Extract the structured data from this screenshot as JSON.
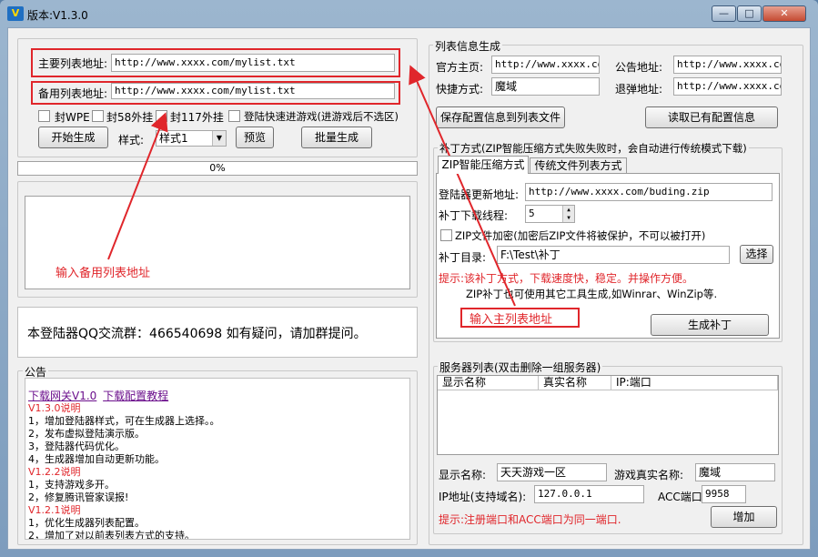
{
  "window": {
    "icon_text": "V",
    "title": "版本:V1.3.0",
    "minimize": "—",
    "maximize": "□",
    "close": "✕"
  },
  "left": {
    "primary_list_label": "主要列表地址:",
    "primary_list_value": "http://www.xxxx.com/mylist.txt",
    "backup_list_label": "备用列表地址:",
    "backup_list_value": "http://www.xxxx.com/mylist.txt",
    "checks": [
      "封WPE",
      "封58外挂",
      "封117外挂",
      "登陆快速进游戏(进游戏后不选区)"
    ],
    "start_button": "开始生成",
    "style_label": "样式:",
    "style_value": "样式1",
    "preview_button": "预览",
    "batch_button": "批量生成",
    "progress": "0%",
    "qq_text": "本登陆器QQ交流群：466540698 如有疑问，请加群提问。",
    "notice_title": "公告",
    "notice_link1": "下载网关V1.0",
    "notice_link2": "下载配置教程",
    "notice_lines": [
      {
        "text": "V1.3.0说明",
        "red": true
      },
      {
        "text": "1，增加登陆器样式，可在生成器上选择。。",
        "red": false
      },
      {
        "text": "2，发布虚拟登陆演示版。",
        "red": false
      },
      {
        "text": "3，登陆器代码优化。",
        "red": false
      },
      {
        "text": "4，生成器增加自动更新功能。",
        "red": false
      },
      {
        "text": "V1.2.2说明",
        "red": true
      },
      {
        "text": "1，支持游戏多开。",
        "red": false
      },
      {
        "text": "2，修复腾讯管家误报!",
        "red": false
      },
      {
        "text": "V1.2.1说明",
        "red": true
      },
      {
        "text": "1，优化生成器列表配置。",
        "red": false
      },
      {
        "text": "2，增加了对以前表列表方式的支持。",
        "red": false
      }
    ]
  },
  "right": {
    "list_group_title": "列表信息生成",
    "homepage_label": "官方主页:",
    "homepage_value": "http://www.xxxx.com",
    "notice_addr_label": "公告地址:",
    "notice_addr_value": "http://www.xxxx.com",
    "shortcut_label": "快捷方式:",
    "shortcut_value": "魔域",
    "recharge_label": "退弹地址:",
    "recharge_value": "http://www.xxxx.com",
    "save_button": "保存配置信息到列表文件",
    "read_button": "读取已有配置信息",
    "patch_group_title": "补丁方式(ZIP智能压缩方式失败失败时，会自动进行传统模式下载)",
    "tab_zip": "ZIP智能压缩方式",
    "tab_legacy": "传统文件列表方式",
    "updater_label": "登陆器更新地址:",
    "updater_value": "http://www.xxxx.com/buding.zip",
    "threads_label": "补丁下载线程:",
    "threads_value": "5",
    "zip_encrypt_label": "ZIP文件加密(加密后ZIP文件将被保护，不可以被打开)",
    "patch_dir_label": "补丁目录:",
    "patch_dir_value": "F:\\Test\\补丁",
    "browse_button": "选择",
    "hint1": "提示:该补丁方式，下载速度快，稳定。并操作方便。",
    "hint2": "ZIP补丁也可使用其它工具生成,如Winrar、WinZip等.",
    "generate_patch_button": "生成补丁",
    "server_group_title": "服务器列表(双击删除一组服务器)",
    "server_columns": [
      "显示名称",
      "真实名称",
      "IP:端口"
    ],
    "display_name_label": "显示名称:",
    "display_name_value": "天天游戏一区",
    "real_name_label": "游戏真实名称:",
    "real_name_value": "魔域",
    "ip_label": "IP地址(支持域名):",
    "ip_value": "127.0.0.1",
    "acc_label": "ACC端口:",
    "acc_value": "9958",
    "server_hint": "提示:注册端口和ACC端口为同一端口.",
    "add_button": "增加"
  },
  "annotations": {
    "backup_note": "输入备用列表地址",
    "primary_note": "输入主列表地址"
  },
  "colors": {
    "annotation_red": "#e0262b",
    "link_purple": "#6b0f8c"
  }
}
